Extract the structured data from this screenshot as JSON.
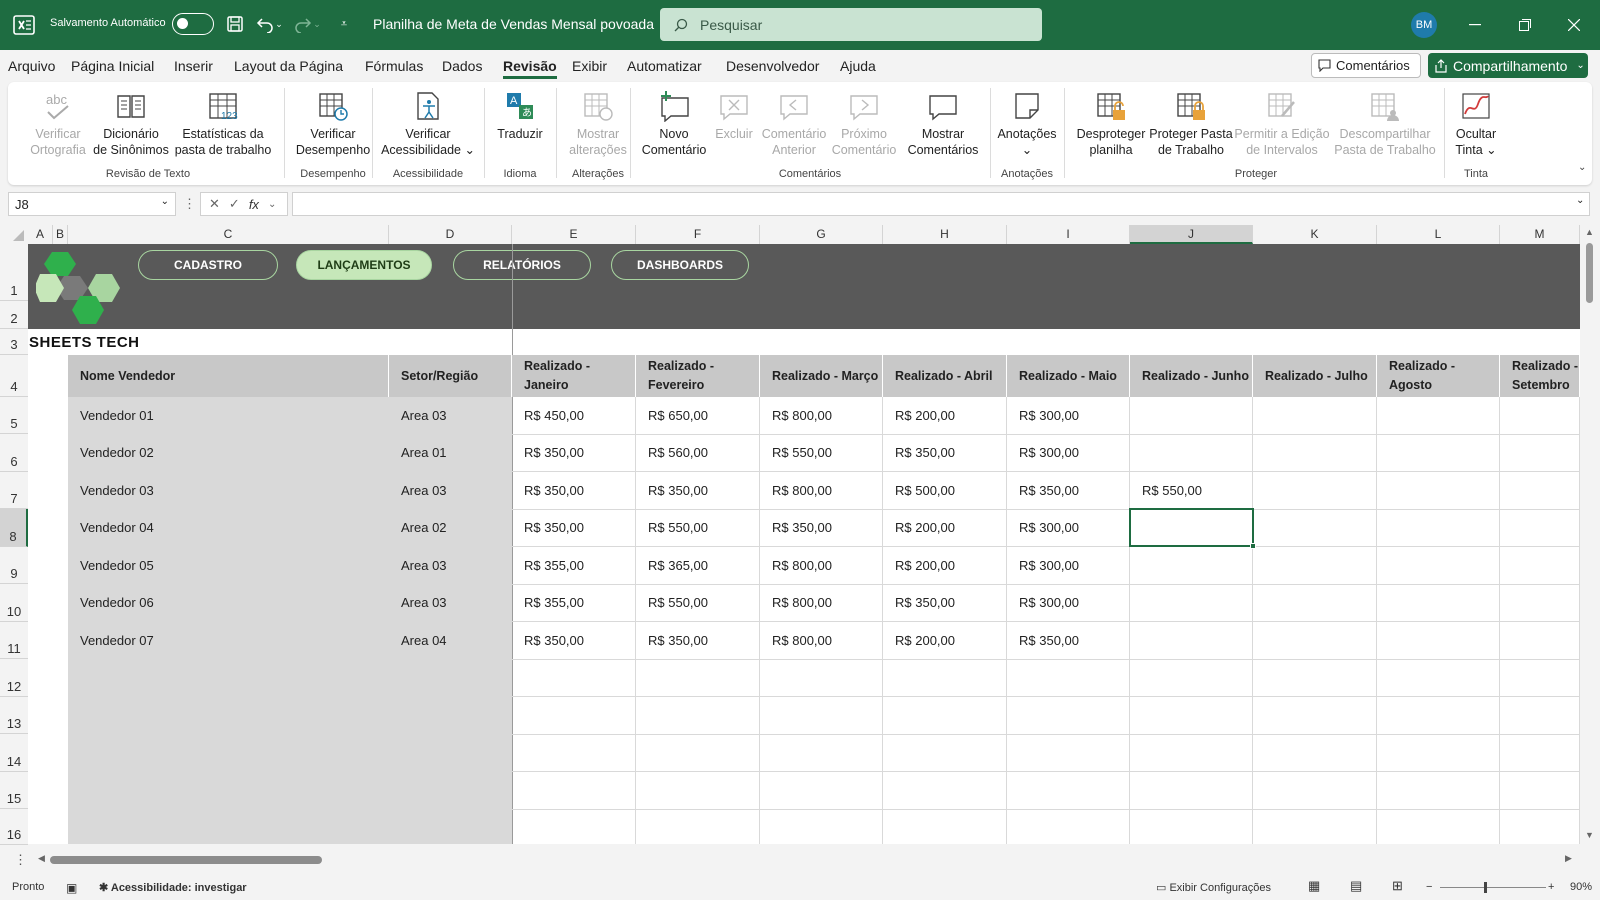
{
  "titlebar": {
    "autosave_label": "Salvamento Automático",
    "doc_title": "Planilha de Meta de Vendas Mensal povoada",
    "search_placeholder": "Pesquisar",
    "avatar": "BM",
    "bg_color": "#1e6c41"
  },
  "menu": {
    "tabs": [
      "Arquivo",
      "Página Inicial",
      "Inserir",
      "Layout da Página",
      "Fórmulas",
      "Dados",
      "Revisão",
      "Exibir",
      "Automatizar",
      "Desenvolvedor",
      "Ajuda"
    ],
    "active_tab": "Revisão",
    "comments_button": "Comentários",
    "share_button": "Compartilhamento"
  },
  "ribbon": {
    "buttons": [
      {
        "l1": "Verificar",
        "l2": "Ortografia",
        "icon": "abc-check-icon",
        "disabled": true
      },
      {
        "l1": "Dicionário",
        "l2": "de Sinônimos",
        "icon": "thesaurus-icon",
        "disabled": false
      },
      {
        "l1": "Estatísticas da",
        "l2": "pasta de trabalho",
        "icon": "workbook-statistics-icon",
        "disabled": false
      },
      {
        "l1": "Verificar",
        "l2": "Desempenho",
        "icon": "performance-icon",
        "disabled": false
      },
      {
        "l1": "Verificar",
        "l2": "Acessibilidade ⌄",
        "icon": "accessibility-icon",
        "disabled": false
      },
      {
        "l1": "Traduzir",
        "l2": "",
        "icon": "translate-icon",
        "disabled": false
      },
      {
        "l1": "Mostrar",
        "l2": "alterações",
        "icon": "show-changes-icon",
        "disabled": true
      },
      {
        "l1": "Novo",
        "l2": "Comentário",
        "icon": "new-comment-icon",
        "disabled": false
      },
      {
        "l1": "Excluir",
        "l2": "",
        "icon": "delete-comment-icon",
        "disabled": true
      },
      {
        "l1": "Comentário",
        "l2": "Anterior",
        "icon": "previous-comment-icon",
        "disabled": true
      },
      {
        "l1": "Próximo",
        "l2": "Comentário",
        "icon": "next-comment-icon",
        "disabled": true
      },
      {
        "l1": "Mostrar",
        "l2": "Comentários",
        "icon": "show-comments-icon",
        "disabled": false
      },
      {
        "l1": "Anotações",
        "l2": "⌄",
        "icon": "notes-icon",
        "disabled": false
      },
      {
        "l1": "Desproteger",
        "l2": "planilha",
        "icon": "unprotect-sheet-icon",
        "disabled": false
      },
      {
        "l1": "Proteger Pasta",
        "l2": "de Trabalho",
        "icon": "protect-workbook-icon",
        "disabled": false
      },
      {
        "l1": "Permitir a Edição",
        "l2": "de Intervalos",
        "icon": "allow-edit-ranges-icon",
        "disabled": true
      },
      {
        "l1": "Descompartilhar",
        "l2": "Pasta de Trabalho",
        "icon": "unshare-workbook-icon",
        "disabled": true
      },
      {
        "l1": "Ocultar",
        "l2": "Tinta ⌄",
        "icon": "hide-ink-icon",
        "disabled": false
      }
    ],
    "groups": [
      "Revisão de Texto",
      "Desempenho",
      "Acessibilidade",
      "Idioma",
      "Alterações",
      "Comentários",
      "Anotações",
      "Proteger",
      "Tinta"
    ]
  },
  "formula_bar": {
    "name_box": "J8",
    "fx": "fx",
    "value": ""
  },
  "columns": [
    "A",
    "B",
    "C",
    "D",
    "E",
    "F",
    "G",
    "H",
    "I",
    "J",
    "K",
    "L",
    "M"
  ],
  "selected_column": "J",
  "rows": [
    "1",
    "2",
    "3",
    "4",
    "5",
    "6",
    "7",
    "8",
    "9",
    "10",
    "11",
    "12",
    "13",
    "14",
    "15",
    "16"
  ],
  "selected_row": "8",
  "sheet": {
    "nav_buttons": [
      "CADASTRO",
      "LANÇAMENTOS",
      "RELATÓRIOS",
      "DASHBOARDS"
    ],
    "active_nav": "LANÇAMENTOS",
    "brand": "SHEETS TECH",
    "banner_color": "#595959",
    "headers": [
      "Nome Vendedor",
      "Setor/Região",
      "Realizado - Janeiro",
      "Realizado - Fevereiro",
      "Realizado - Março",
      "Realizado - Abril",
      "Realizado - Maio",
      "Realizado - Junho",
      "Realizado - Julho",
      "Realizado - Agosto",
      "Realizado - Setembro"
    ],
    "data": [
      [
        "Vendedor 01",
        "Area 03",
        "R$ 450,00",
        "R$ 650,00",
        "R$ 800,00",
        "R$ 200,00",
        "R$ 300,00",
        "",
        "",
        "",
        ""
      ],
      [
        "Vendedor 02",
        "Area 01",
        "R$ 350,00",
        "R$ 560,00",
        "R$ 550,00",
        "R$ 350,00",
        "R$ 300,00",
        "",
        "",
        "",
        ""
      ],
      [
        "Vendedor 03",
        "Area 03",
        "R$ 350,00",
        "R$ 350,00",
        "R$ 800,00",
        "R$ 500,00",
        "R$ 350,00",
        "R$ 550,00",
        "",
        "",
        ""
      ],
      [
        "Vendedor 04",
        "Area 02",
        "R$ 350,00",
        "R$ 550,00",
        "R$ 350,00",
        "R$ 200,00",
        "R$ 300,00",
        "",
        "",
        "",
        ""
      ],
      [
        "Vendedor 05",
        "Area 03",
        "R$ 355,00",
        "R$ 365,00",
        "R$ 800,00",
        "R$ 200,00",
        "R$ 300,00",
        "",
        "",
        "",
        ""
      ],
      [
        "Vendedor 06",
        "Area 03",
        "R$ 355,00",
        "R$ 550,00",
        "R$ 800,00",
        "R$ 350,00",
        "R$ 300,00",
        "",
        "",
        "",
        ""
      ],
      [
        "Vendedor 07",
        "Area 04",
        "R$ 350,00",
        "R$ 350,00",
        "R$ 800,00",
        "R$ 200,00",
        "R$ 350,00",
        "",
        "",
        "",
        ""
      ]
    ]
  },
  "status": {
    "ready": "Pronto",
    "accessibility": "Acessibilidade: investigar",
    "display_settings": "Exibir Configurações",
    "zoom": "90%"
  }
}
